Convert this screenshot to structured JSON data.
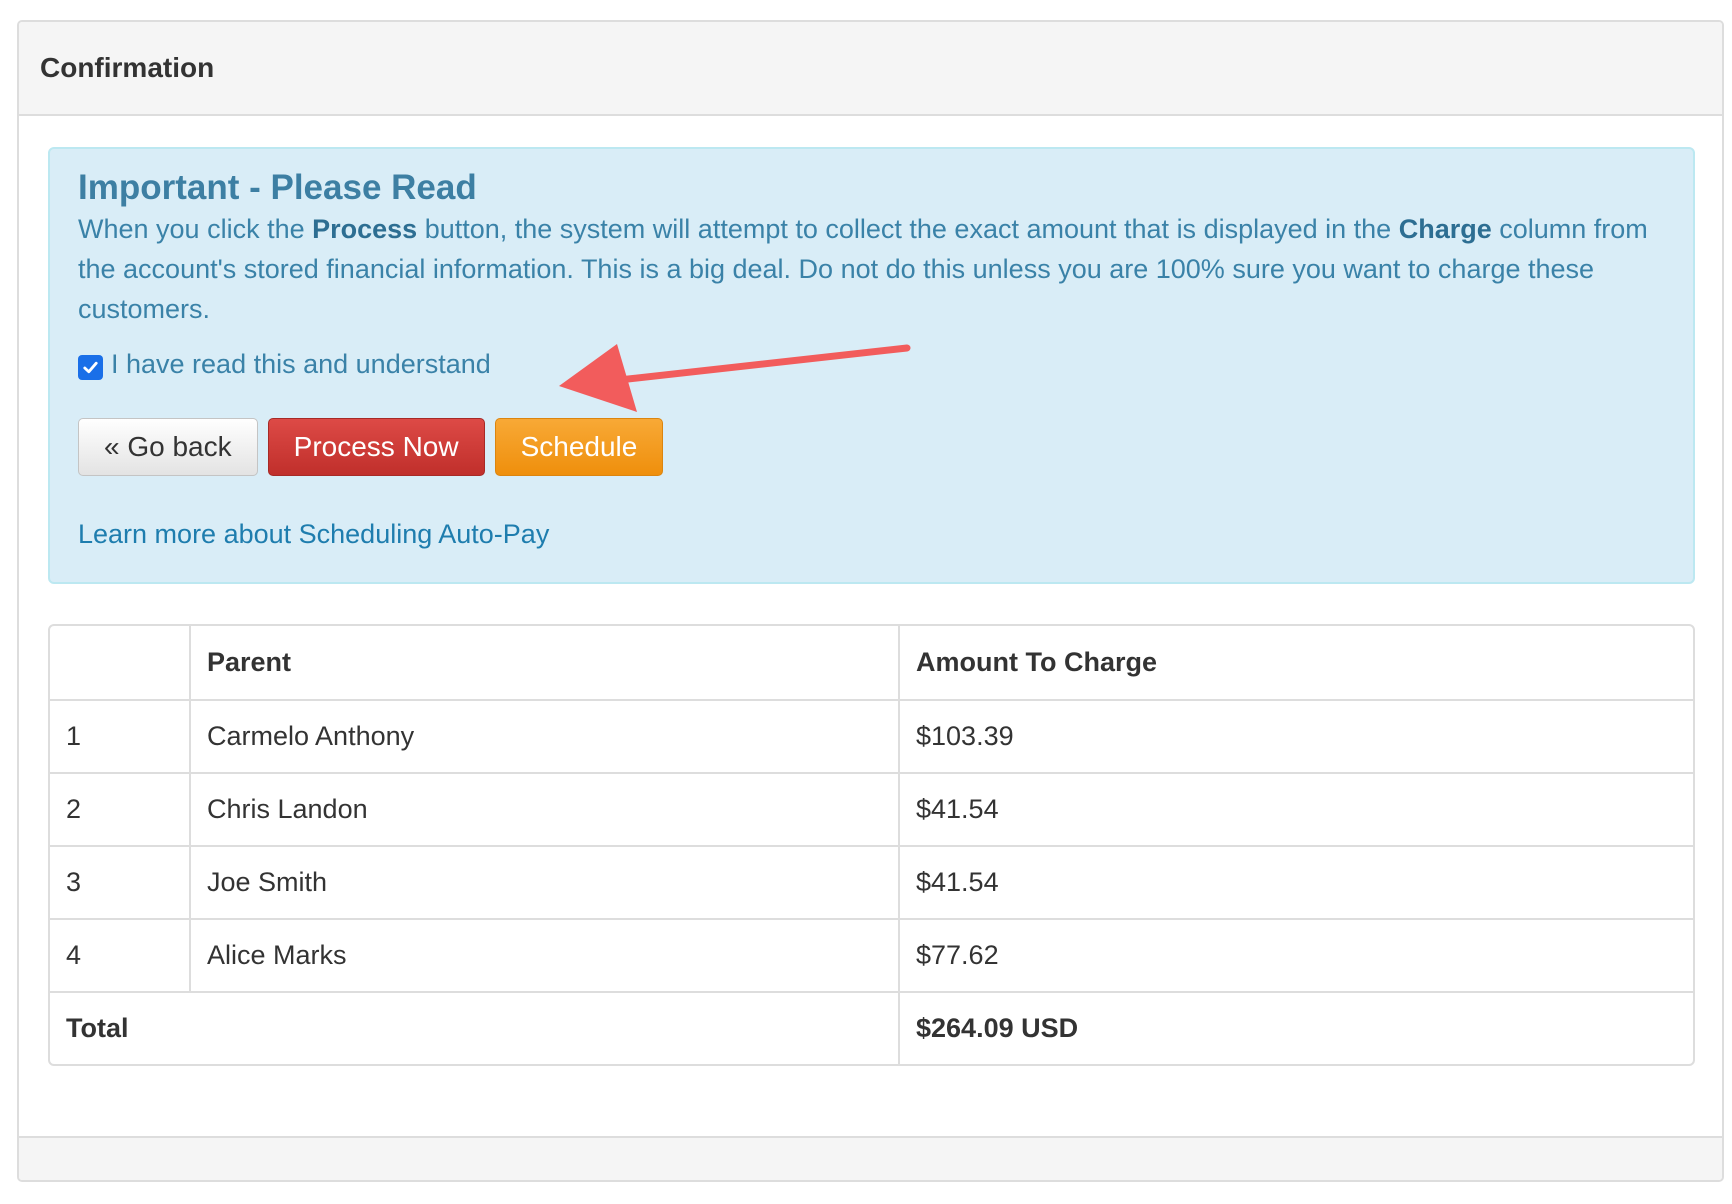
{
  "panel": {
    "title": "Confirmation"
  },
  "alert": {
    "title": "Important - Please Read",
    "text": {
      "part1": "When you click the ",
      "bold1": "Process",
      "part2": " button, the system will attempt to collect the exact amount that is displayed in the ",
      "bold2": "Charge",
      "part3": " column from the account's stored financial information. This is a big deal. Do not do this unless you are 100% sure you want to charge these customers."
    },
    "confirm_label": "I have read this and understand",
    "confirm_checked": true,
    "buttons": {
      "go_back": "« Go back",
      "process_now": "Process Now",
      "schedule": "Schedule"
    },
    "learn_more": "Learn more about Scheduling Auto-Pay"
  },
  "table": {
    "headers": [
      "",
      "Parent",
      "Amount To Charge"
    ],
    "rows": [
      {
        "num": "1",
        "parent": "Carmelo Anthony",
        "amount": "$103.39"
      },
      {
        "num": "2",
        "parent": "Chris Landon",
        "amount": "$41.54"
      },
      {
        "num": "3",
        "parent": "Joe Smith",
        "amount": "$41.54"
      },
      {
        "num": "4",
        "parent": "Alice Marks",
        "amount": "$77.62"
      }
    ],
    "total_label": "Total",
    "total_value": "$264.09 USD"
  },
  "colors": {
    "alert_bg": "#d9edf7",
    "danger": "#c9302c",
    "warning": "#f0ad4e",
    "annotation_arrow": "#f25c5c"
  }
}
